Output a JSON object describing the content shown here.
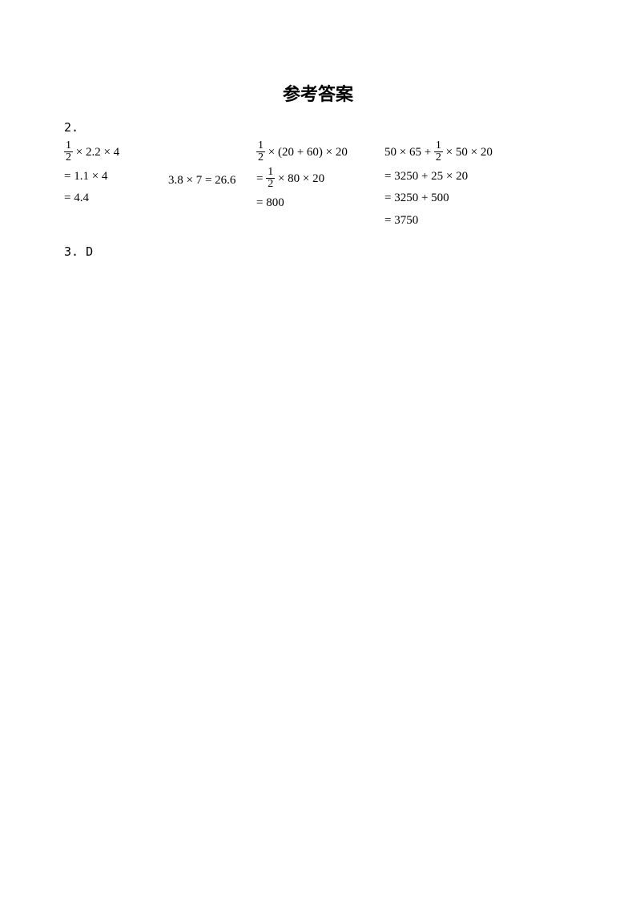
{
  "title": "参考答案",
  "q2_label": "2.",
  "frac": {
    "num": "1",
    "den": "2"
  },
  "col1": {
    "l1_rest": " × 2.2 × 4",
    "l2": "= 1.1 × 4",
    "l3": "= 4.4"
  },
  "col2": {
    "l1": "3.8 × 7 = 26.6"
  },
  "col3": {
    "l1_rest": " × (20 + 60) × 20",
    "l2_eq": "= ",
    "l2_rest": " × 80 × 20",
    "l3": "= 800"
  },
  "col4": {
    "l1_pre": "50 × 65 + ",
    "l1_rest": " × 50 × 20",
    "l2": "= 3250 + 25 × 20",
    "l3": "= 3250 + 500",
    "l4": "= 3750"
  },
  "q3_label": "3. D"
}
